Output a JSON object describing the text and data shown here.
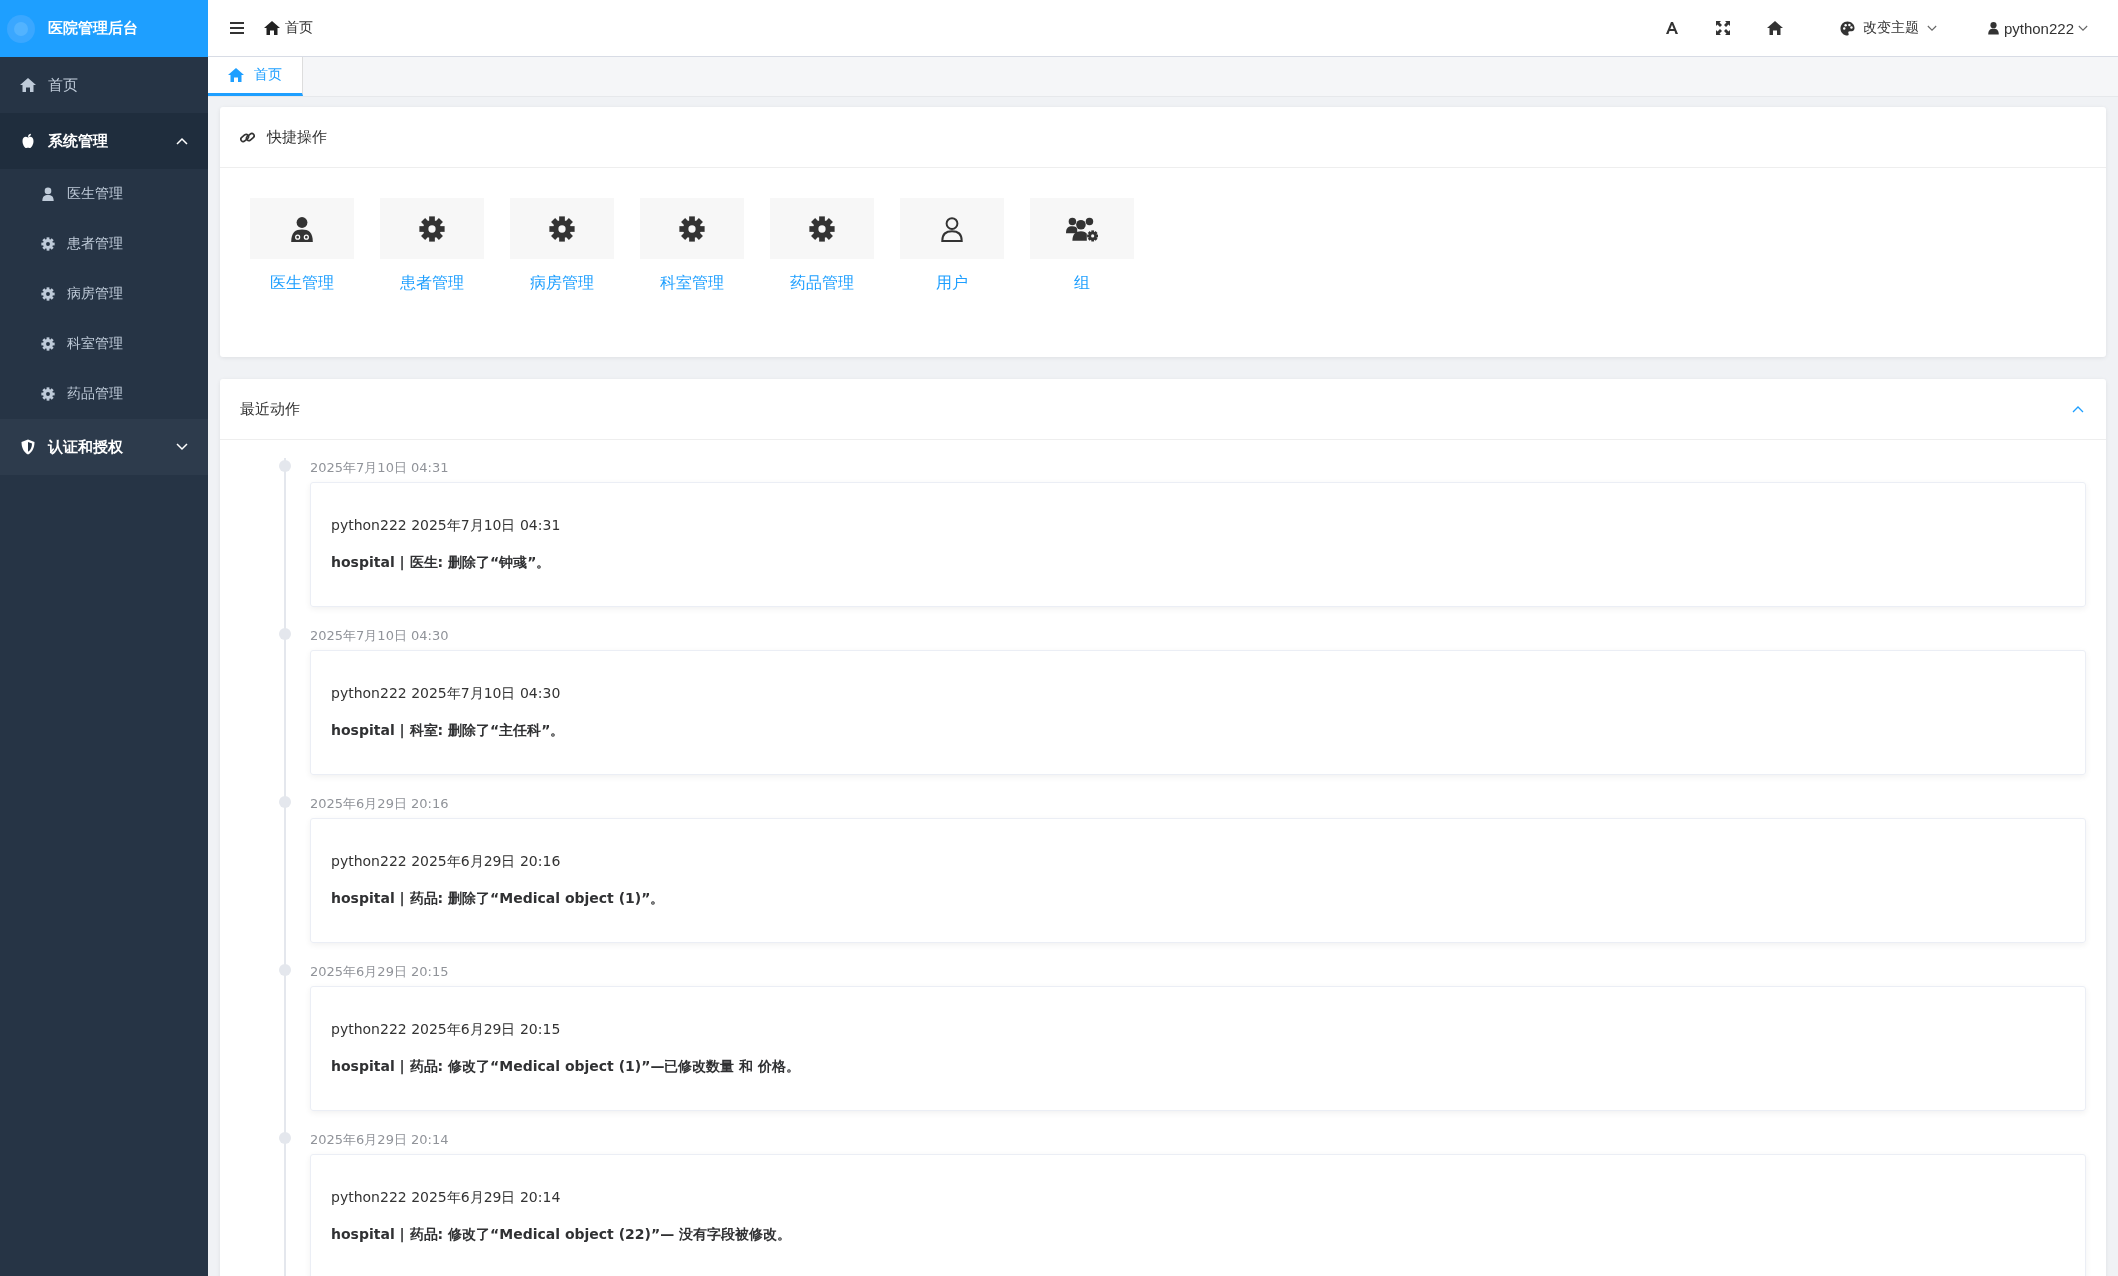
{
  "sidebar": {
    "title": "医院管理后台",
    "items": [
      {
        "kind": "link",
        "label": "首页"
      },
      {
        "kind": "group",
        "label": "系统管理",
        "expanded": true,
        "children": [
          {
            "label": "医生管理"
          },
          {
            "label": "患者管理"
          },
          {
            "label": "病房管理"
          },
          {
            "label": "科室管理"
          },
          {
            "label": "药品管理"
          }
        ]
      },
      {
        "kind": "group",
        "label": "认证和授权",
        "expanded": false
      }
    ]
  },
  "topbar": {
    "breadcrumb": "首页",
    "theme": "改变主题",
    "user": "python222"
  },
  "tabs": [
    {
      "label": "首页",
      "selected": true
    }
  ],
  "quick_actions": {
    "title": "快捷操作",
    "items": [
      "医生管理",
      "患者管理",
      "病房管理",
      "科室管理",
      "药品管理",
      "用户",
      "组"
    ]
  },
  "recent_actions": {
    "title": "最近动作",
    "expanded": true,
    "entries": [
      {
        "time": "2025年7月10日 04:31",
        "user_line": "python222 2025年7月10日 04:31",
        "action": "hospital | 医生: 删除了“钟彧”。"
      },
      {
        "time": "2025年7月10日 04:30",
        "user_line": "python222 2025年7月10日 04:30",
        "action": "hospital | 科室: 删除了“主任科”。"
      },
      {
        "time": "2025年6月29日 20:16",
        "user_line": "python222 2025年6月29日 20:16",
        "action": "hospital | 药品: 删除了“Medical object (1)”。"
      },
      {
        "time": "2025年6月29日 20:15",
        "user_line": "python222 2025年6月29日 20:15",
        "action": "hospital | 药品: 修改了“Medical object (1)”—已修改数量 和 价格。"
      },
      {
        "time": "2025年6月29日 20:14",
        "user_line": "python222 2025年6月29日 20:14",
        "action": "hospital | 药品: 修改了“Medical object (22)”— 没有字段被修改。"
      }
    ]
  }
}
